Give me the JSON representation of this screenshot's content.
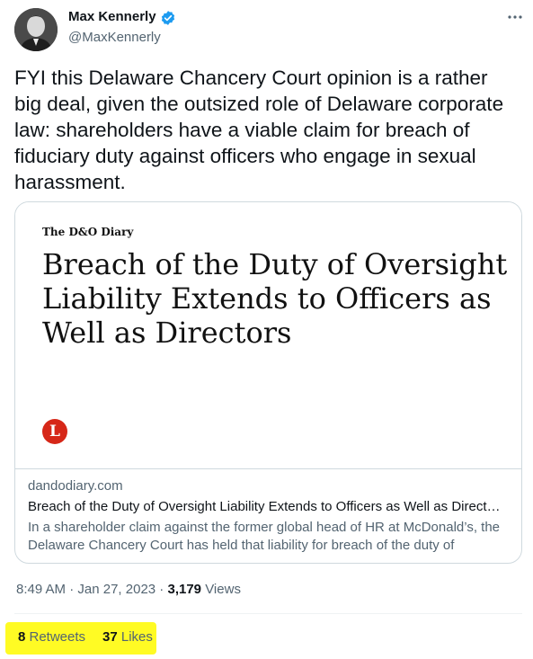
{
  "author": {
    "name": "Max Kennerly",
    "handle": "@MaxKennerly",
    "verified_color": "#1d9bf0"
  },
  "tweet": {
    "text": "FYI this Delaware Chancery Court opinion is a rather big deal, given the outsized role of Delaware corporate law: shareholders have a viable claim for breach of fiduciary duty against officers who engage in sexual harassment."
  },
  "card": {
    "brand": "The D&O Diary",
    "headline": "Breach of the Duty of Oversight Liability Extends to Officers as Well as Directors",
    "logo_letter": "L",
    "logo_color": "#d62718",
    "domain": "dandodiary.com",
    "title": "Breach of the Duty of Oversight Liability Extends to Officers as Well as Direct…",
    "description": "In a shareholder claim against the former global head of HR at McDonald’s, the Delaware Chancery Court has held that liability for breach of the duty of"
  },
  "meta": {
    "time": "8:49 AM",
    "separator": " · ",
    "date": "Jan 27, 2023",
    "separator2": " · ",
    "views": "3,179",
    "views_label": " Views"
  },
  "stats": {
    "retweets": "8",
    "retweets_label": " Retweets",
    "likes": "37",
    "likes_label": " Likes",
    "highlight_color": "#fffb24"
  },
  "icons": {
    "more": "more-dots-icon",
    "verified": "verified-badge-icon"
  }
}
